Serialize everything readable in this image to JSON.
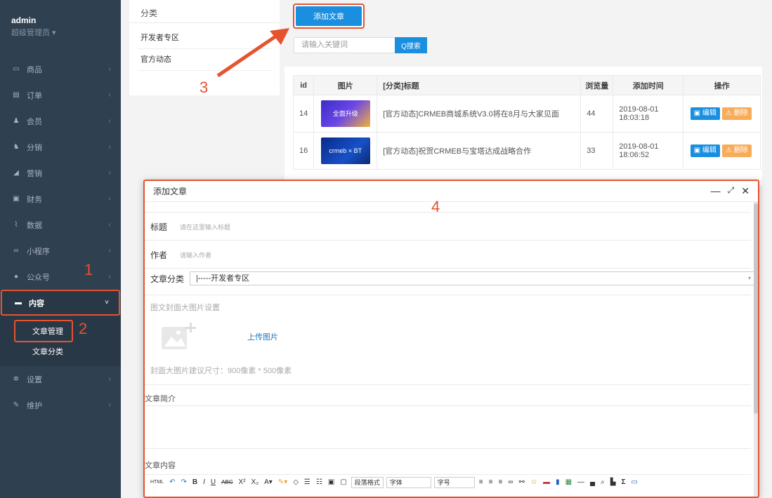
{
  "sidebar": {
    "user": "admin",
    "role": "超级管理员 ▾",
    "items": [
      {
        "label": "商品",
        "icon": "monitor-icon",
        "glyph": "▭"
      },
      {
        "label": "订单",
        "icon": "order-icon",
        "glyph": "▤"
      },
      {
        "label": "会员",
        "icon": "user-icon",
        "glyph": "♟"
      },
      {
        "label": "分销",
        "icon": "users-icon",
        "glyph": "♞"
      },
      {
        "label": "营销",
        "icon": "send-icon",
        "glyph": "◢"
      },
      {
        "label": "财务",
        "icon": "money-icon",
        "glyph": "▣"
      },
      {
        "label": "数据",
        "icon": "chart-icon",
        "glyph": "⌇"
      },
      {
        "label": "小程序",
        "icon": "link-icon",
        "glyph": "∞"
      },
      {
        "label": "公众号",
        "icon": "chat-icon",
        "glyph": "●"
      },
      {
        "label": "内容",
        "icon": "book-icon",
        "glyph": "▬"
      },
      {
        "label": "设置",
        "icon": "gear-icon",
        "glyph": "✲"
      },
      {
        "label": "维护",
        "icon": "wrench-icon",
        "glyph": "✎"
      }
    ],
    "sub_items": [
      "文章管理",
      "文章分类"
    ]
  },
  "category_panel": {
    "title": "分类",
    "items": [
      "开发者专区",
      "官方动态"
    ]
  },
  "toolbar": {
    "add_label": "添加文章",
    "search_placeholder": "请输入关键词",
    "search_label": "Q搜索"
  },
  "table": {
    "headers": [
      "id",
      "图片",
      "[分类]标题",
      "浏览量",
      "添加时间",
      "操作"
    ],
    "rows": [
      {
        "id": "14",
        "title": "[官方动态]CRMEB商城系统V3.0将在8月与大家见面",
        "views": "44",
        "date": "2019-08-01",
        "time": "18:03:18",
        "thumb_text": "全面升级"
      },
      {
        "id": "16",
        "title": "[官方动态]祝贺CRMEB与宝塔达成战略合作",
        "views": "33",
        "date": "2019-08-01",
        "time": "18:06:52",
        "thumb_text": "crmeb × BT"
      }
    ],
    "edit_label": "编辑",
    "delete_label": "删除"
  },
  "annotations": [
    "1",
    "2",
    "3",
    "4"
  ],
  "modal": {
    "title": "添加文章",
    "title_label": "标题",
    "title_placeholder": "请在这里输入标题",
    "author_label": "作者",
    "author_placeholder": "请输入作者",
    "category_label": "文章分类",
    "category_value": "|-----开发者专区",
    "cover_label": "图文封面大图片设置",
    "upload_label": "上传图片",
    "cover_hint": "封面大图片建议尺寸：900像素 * 500像素",
    "summary_label": "文章简介",
    "content_label": "文章内容",
    "editor_selects": [
      "段落格式",
      "字体",
      "字号"
    ]
  },
  "colors": {
    "sidebar_bg": "#2f4050",
    "primary": "#1a8fe0",
    "warning": "#f8ac59",
    "annotation": "#e5532f"
  }
}
